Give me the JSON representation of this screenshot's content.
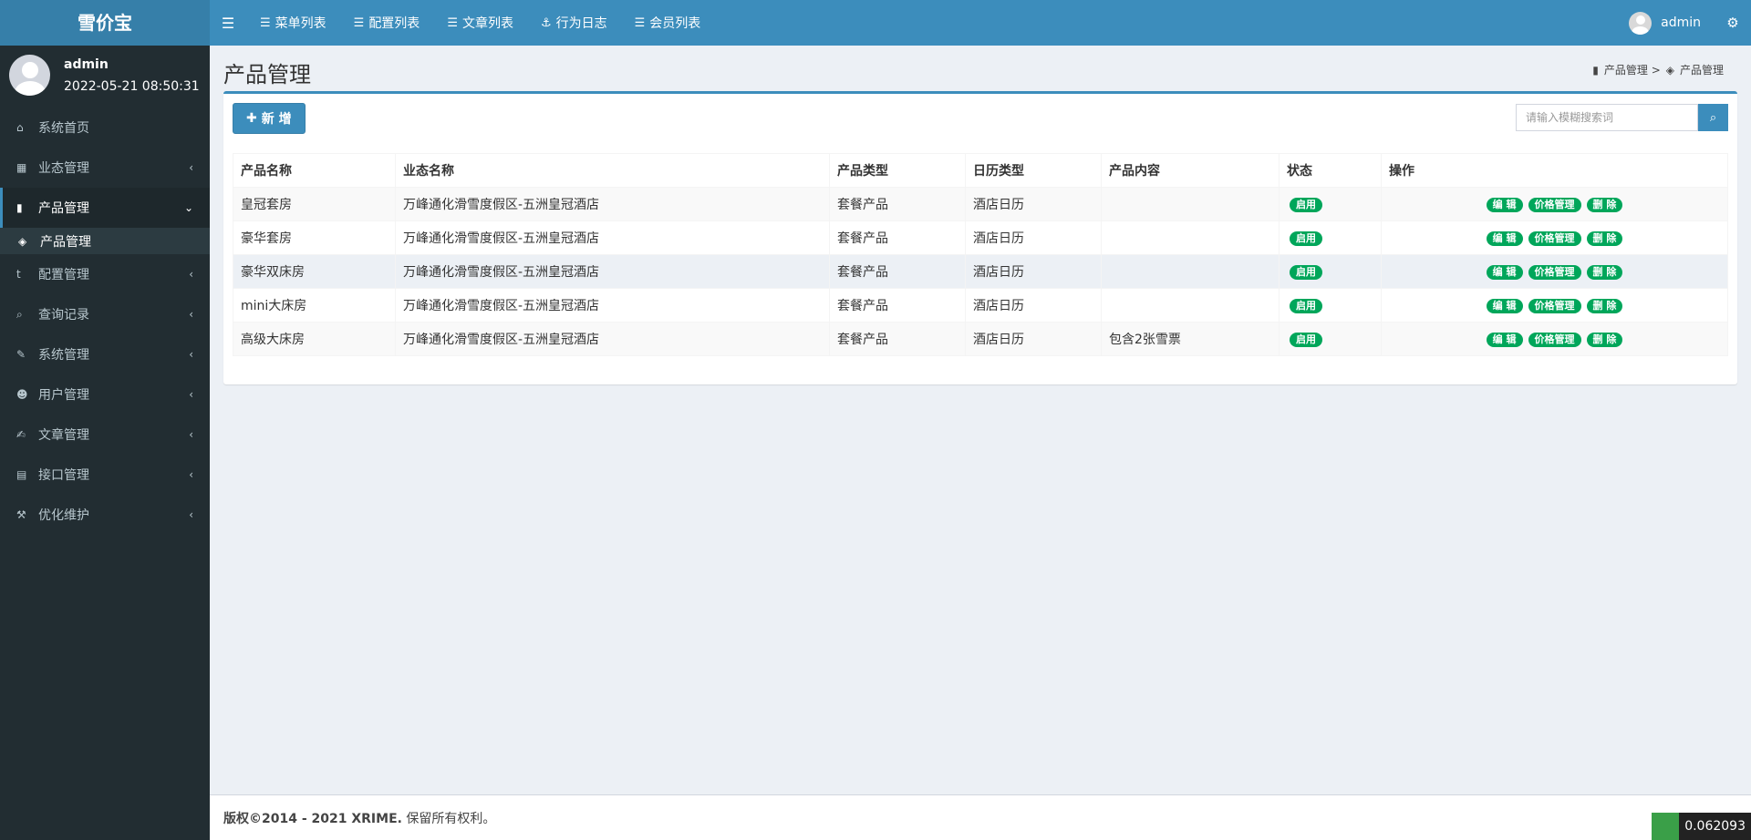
{
  "app": {
    "title": "雪价宝"
  },
  "topnav": {
    "items": [
      {
        "label": "菜单列表",
        "icon": "list-icon"
      },
      {
        "label": "配置列表",
        "icon": "list-icon"
      },
      {
        "label": "文章列表",
        "icon": "list-icon"
      },
      {
        "label": "行为日志",
        "icon": "anchor-icon"
      },
      {
        "label": "会员列表",
        "icon": "list-icon"
      }
    ],
    "user": "admin"
  },
  "user_panel": {
    "name": "admin",
    "time": "2022-05-21 08:50:31"
  },
  "sidebar": {
    "items": [
      {
        "label": "系统首页",
        "icon": "home-icon"
      },
      {
        "label": "业态管理",
        "icon": "grid-icon"
      },
      {
        "label": "产品管理",
        "icon": "bookmark-icon"
      },
      {
        "label": "配置管理",
        "icon": "tumblr-icon"
      },
      {
        "label": "查询记录",
        "icon": "search-icon"
      },
      {
        "label": "系统管理",
        "icon": "wrench-icon"
      },
      {
        "label": "用户管理",
        "icon": "users-icon"
      },
      {
        "label": "文章管理",
        "icon": "edit-icon"
      },
      {
        "label": "接口管理",
        "icon": "book-icon"
      },
      {
        "label": "优化维护",
        "icon": "gavel-icon"
      }
    ],
    "subitem": {
      "label": "产品管理",
      "icon": "tags-icon"
    }
  },
  "page": {
    "title": "产品管理",
    "breadcrumb": {
      "first": "产品管理 >",
      "second": "产品管理"
    }
  },
  "toolbar": {
    "add_label": "新 增",
    "search_placeholder": "请输入模糊搜索词"
  },
  "table": {
    "headers": [
      "产品名称",
      "业态名称",
      "产品类型",
      "日历类型",
      "产品内容",
      "状态",
      "操作"
    ],
    "rows": [
      {
        "name": "皇冠套房",
        "venue": "万峰通化滑雪度假区-五洲皇冠酒店",
        "type": "套餐产品",
        "calendar": "酒店日历",
        "content": "",
        "status": "启用"
      },
      {
        "name": "豪华套房",
        "venue": "万峰通化滑雪度假区-五洲皇冠酒店",
        "type": "套餐产品",
        "calendar": "酒店日历",
        "content": "",
        "status": "启用"
      },
      {
        "name": "豪华双床房",
        "venue": "万峰通化滑雪度假区-五洲皇冠酒店",
        "type": "套餐产品",
        "calendar": "酒店日历",
        "content": "",
        "status": "启用"
      },
      {
        "name": "mini大床房",
        "venue": "万峰通化滑雪度假区-五洲皇冠酒店",
        "type": "套餐产品",
        "calendar": "酒店日历",
        "content": "",
        "status": "启用"
      },
      {
        "name": "高级大床房",
        "venue": "万峰通化滑雪度假区-五洲皇冠酒店",
        "type": "套餐产品",
        "calendar": "酒店日历",
        "content": "包含2张雪票",
        "status": "启用"
      }
    ],
    "actions": {
      "edit": "编 辑",
      "price": "价格管理",
      "delete": "删 除"
    }
  },
  "footer": {
    "copyright": "版权©2014 - 2021 XRIME.",
    "rights": " 保留所有权利。"
  },
  "perf": {
    "value": "0.062093"
  },
  "colors": {
    "header": "#3c8dbc",
    "logo": "#367fa9",
    "sidebar": "#222d32",
    "success": "#00a65a"
  }
}
